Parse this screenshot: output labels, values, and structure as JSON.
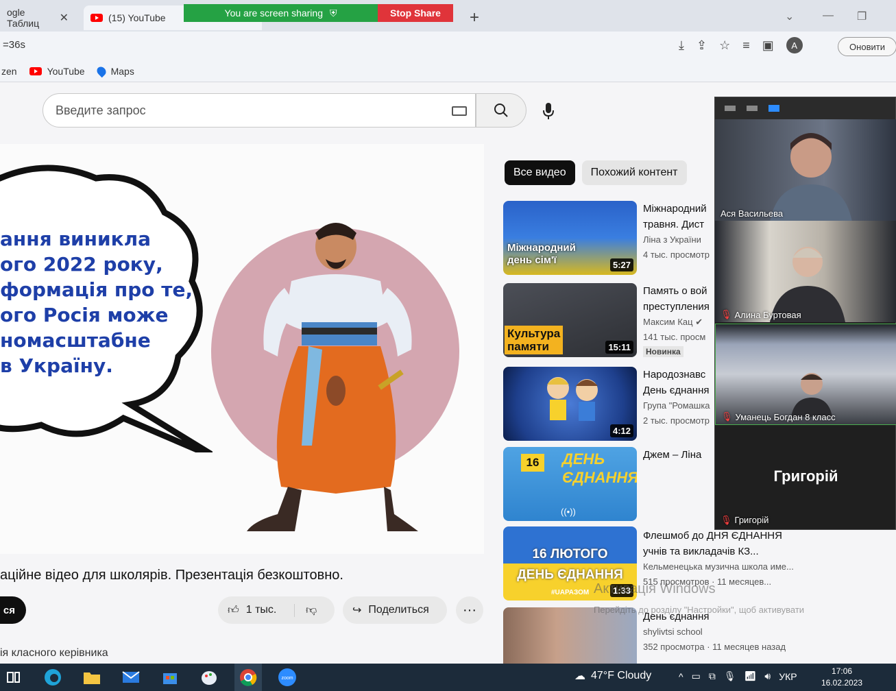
{
  "browser": {
    "tabs": [
      {
        "label": "ogle Таблиц",
        "close": "✕"
      },
      {
        "label": "(15) YouTube"
      }
    ],
    "share_banner": "You are screen sharing",
    "stop_share": "Stop Share",
    "new_tab": "+",
    "url": "=36s",
    "update_button": "Оновити",
    "profile_initial": "A",
    "bookmarks": [
      "zen",
      "YouTube",
      "Maps"
    ]
  },
  "youtube": {
    "search_placeholder": "Введите запрос",
    "video": {
      "overlay_text": "ання виникла\nого 2022 року,\nформація про те,\nого Росія може\nномасштабне\nв Україну.",
      "progress": 0.09
    },
    "title": "аційне відео для школярів. Презентація безкоштовно.",
    "subscribe": "ся",
    "likes": "1 тыс.",
    "share": "Поделиться",
    "more": "···",
    "description": "ія класного керівника",
    "chips": [
      "Все видео",
      "Похожий контент"
    ],
    "recommendations": [
      {
        "title1": "Міжнародний",
        "title2": "травня. Дист",
        "channel": "Ліна з України",
        "meta": "4 тыс. просмотр",
        "duration": "5:27",
        "thumb_text": "Міжнародний\nдень сім'ї"
      },
      {
        "title1": "Память о вой",
        "title2": "преступления",
        "channel": "Максим Кац",
        "meta": "141 тыс. просм",
        "badge": "Новинка",
        "duration": "15:11",
        "thumb_text": "Культура\nпамяти"
      },
      {
        "title1": "Народознавс",
        "title2": "День єднання",
        "channel": "Група \"Ромашка",
        "meta": "2 тыс. просмотр",
        "duration": "4:12"
      },
      {
        "title1": "Джем – Ліна",
        "thumb_text": "ДЕНЬ\nЄДНАННЯ",
        "thumb_num": "16"
      },
      {
        "title1": "Флешмоб до ДНЯ ЄДНАННЯ",
        "title2": "учнів та викладачів КЗ...",
        "channel": "Кельменецька музична школа име...",
        "meta": "515 просмотров · 11 месяцев...",
        "duration": "1:33",
        "thumb_text": "16 ЛЮТОГО\nДЕНЬ ЄДНАННЯ",
        "thumb_tag": "#UAРАЗОМ"
      },
      {
        "title1": "День єднання",
        "channel": "shylivtsi school",
        "meta": "352 просмотра · 11 месяцев назад"
      }
    ],
    "activate_windows": "Активація Windows",
    "activate_hint": "Перейдіть до розділу \"Настройки\", щоб активувати"
  },
  "zoom": {
    "participants": [
      "Ася Васильева",
      "Алина Буртовая",
      "Уманець Богдан 8 класс",
      "Григорій"
    ],
    "big_name": "Григорій"
  },
  "taskbar": {
    "weather": "47°F  Cloudy",
    "language": "УКР",
    "time": "17:06",
    "date": "16.02.2023"
  }
}
